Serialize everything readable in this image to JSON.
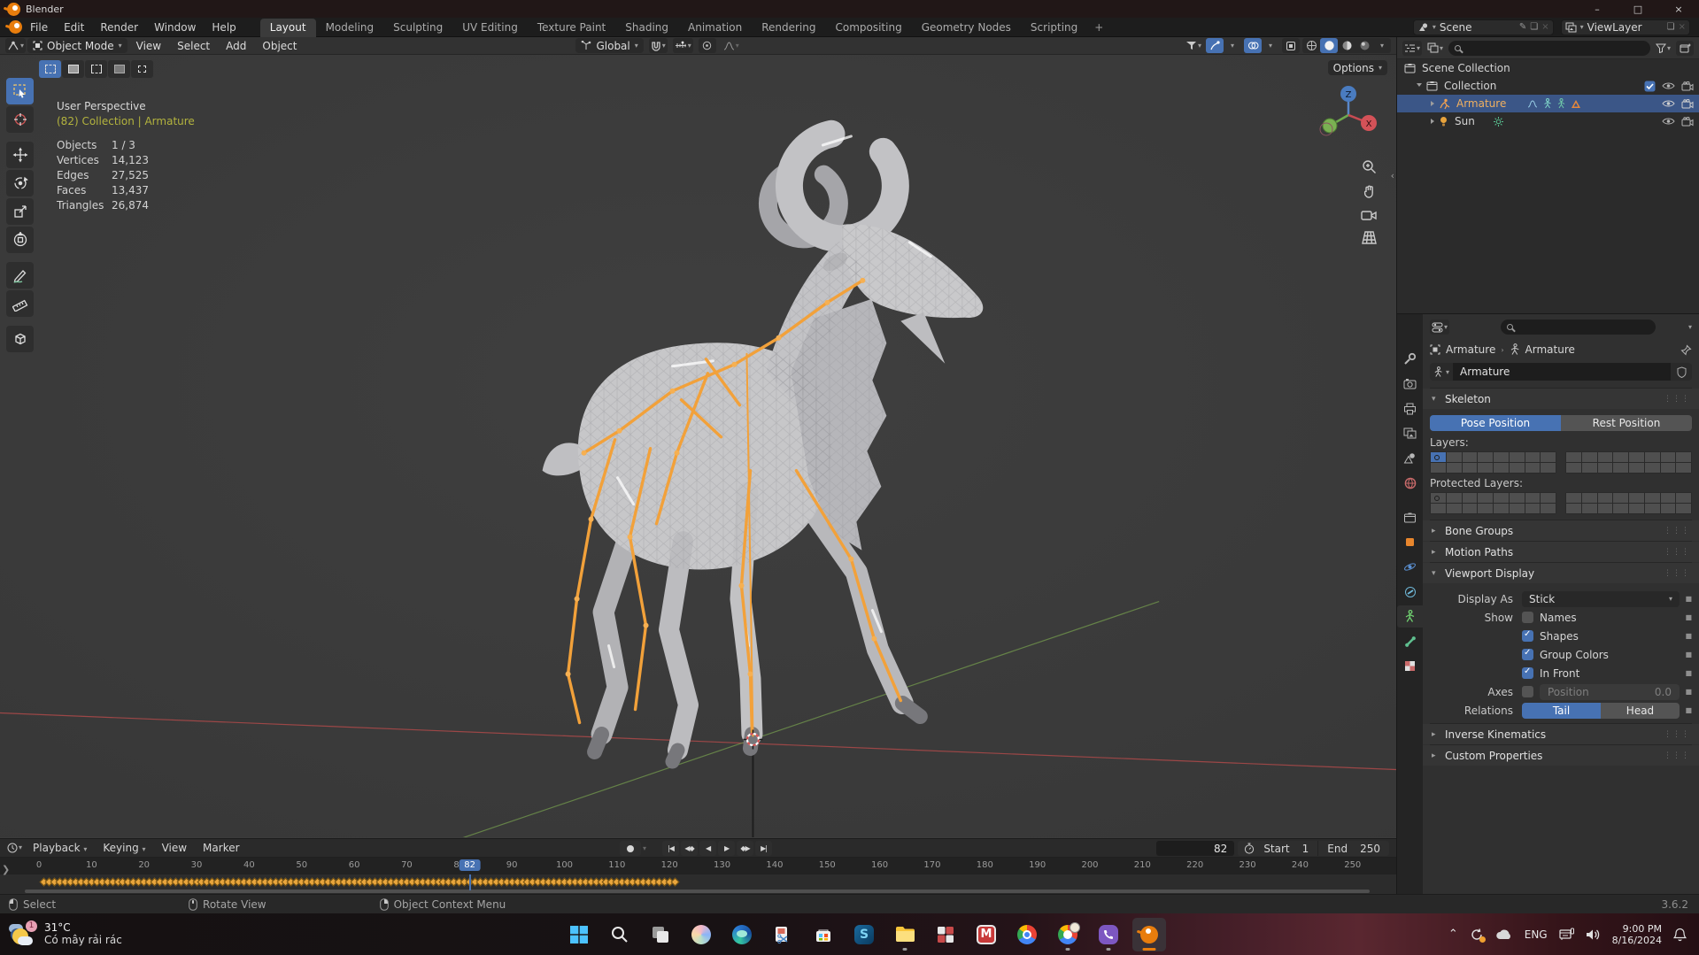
{
  "titlebar": {
    "title": "Blender",
    "minimize": "–",
    "maximize": "□",
    "close": "×"
  },
  "topbar": {
    "menus": [
      "File",
      "Edit",
      "Render",
      "Window",
      "Help"
    ],
    "tabs": [
      "Layout",
      "Modeling",
      "Sculpting",
      "UV Editing",
      "Texture Paint",
      "Shading",
      "Animation",
      "Rendering",
      "Compositing",
      "Geometry Nodes",
      "Scripting"
    ],
    "new_tab": "+",
    "scene": "Scene",
    "viewlayer": "ViewLayer"
  },
  "viewport": {
    "mode": "Object Mode",
    "menus": [
      "View",
      "Select",
      "Add",
      "Object"
    ],
    "orientation": "Global",
    "options": "Options",
    "info": {
      "view": "User Perspective",
      "context": "(82) Collection | Armature",
      "stats": [
        {
          "label": "Objects",
          "value": "1 / 3"
        },
        {
          "label": "Vertices",
          "value": "14,123"
        },
        {
          "label": "Edges",
          "value": "27,525"
        },
        {
          "label": "Faces",
          "value": "13,437"
        },
        {
          "label": "Triangles",
          "value": "26,874"
        }
      ]
    },
    "gizmo": {
      "z": "Z",
      "x": "X"
    }
  },
  "outliner": {
    "rows": [
      {
        "label": "Scene Collection"
      },
      {
        "label": "Collection"
      },
      {
        "label": "Armature"
      },
      {
        "label": "Sun"
      }
    ]
  },
  "properties": {
    "breadcrumb": {
      "object": "Armature",
      "data": "Armature"
    },
    "name": "Armature",
    "skeleton": {
      "title": "Skeleton",
      "pose": "Pose Position",
      "rest": "Rest Position",
      "layers": "Layers:",
      "protected": "Protected Layers:"
    },
    "sections": {
      "bone_groups": "Bone Groups",
      "motion_paths": "Motion Paths",
      "viewport_display": "Viewport Display",
      "inverse_kinematics": "Inverse Kinematics",
      "custom_properties": "Custom Properties"
    },
    "viewport_display": {
      "display_as_label": "Display As",
      "display_as": "Stick",
      "show_label": "Show",
      "checks": [
        {
          "label": "Names",
          "checked": false
        },
        {
          "label": "Shapes",
          "checked": true
        },
        {
          "label": "Group Colors",
          "checked": true
        },
        {
          "label": "In Front",
          "checked": true
        }
      ],
      "axes_label": "Axes",
      "position_label": "Position",
      "position_value": "0.0",
      "relations_label": "Relations",
      "tail": "Tail",
      "head": "Head"
    }
  },
  "timeline": {
    "menus": [
      "Playback",
      "Keying",
      "View",
      "Marker"
    ],
    "frame": "82",
    "frame_num": 82,
    "start_label": "Start",
    "start": "1",
    "end_label": "End",
    "end": "250",
    "tick_min": 0,
    "tick_max": 250,
    "tick_step": 10,
    "keyframes": {
      "from": 1,
      "to": 121
    }
  },
  "statusbar": {
    "hints": [
      {
        "label": "Select"
      },
      {
        "label": "Rotate View"
      },
      {
        "label": "Object Context Menu"
      }
    ],
    "version": "3.6.2"
  },
  "taskbar": {
    "weather": {
      "temp": "31°C",
      "desc": "Có mây rải rác",
      "badge": "1"
    },
    "tray": {
      "lang": "ENG",
      "time": "9:00 PM",
      "date": "8/16/2024"
    }
  },
  "colors": {
    "accent": "#4772b3",
    "keyframe": "#e9a53c",
    "bone": "#f2a13a"
  }
}
